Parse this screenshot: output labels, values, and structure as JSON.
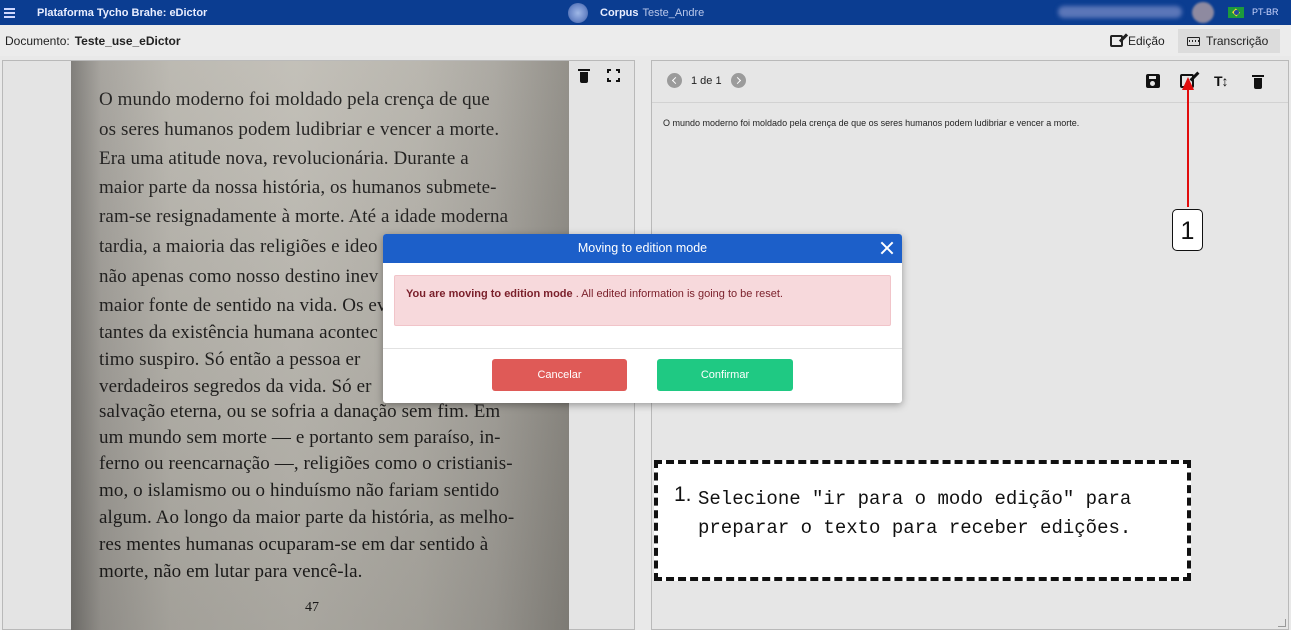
{
  "header": {
    "app_title": "Plataforma Tycho Brahe: eDictor",
    "corpus_label": "Corpus",
    "corpus_name": "Teste_Andre",
    "language": "PT-BR"
  },
  "docbar": {
    "doc_label": "Documento:",
    "doc_name": "Teste_use_eDictor",
    "edicao_label": "Edição",
    "transcricao_label": "Transcrição"
  },
  "book": {
    "lines": [
      "O mundo moderno foi moldado pela crença de que",
      "os seres humanos podem ludibriar e vencer a morte.",
      "Era uma atitude nova, revolucionária. Durante a",
      "maior parte da nossa história, os humanos submete-",
      "ram-se resignadamente à morte. Até a idade moderna",
      "tardia, a maioria das religiões e ideo",
      "não apenas como nosso destino inev",
      "maior fonte de sentido na vida. Os ev",
      "tantes da existência humana acontec",
      "timo suspiro. Só então a pessoa er",
      "verdadeiros segredos da vida. Só er",
      "salvação eterna, ou se sofria a danação sem fim. Em",
      "um mundo sem morte — e portanto sem paraíso, in-",
      "ferno ou reencarnação —, religiões como o cristianis-",
      "mo, o islamismo ou o hinduísmo não fariam sentido",
      "algum. Ao longo da maior parte da história, as melho-",
      "res mentes humanas ocuparam-se em dar sentido à",
      "morte, não em lutar para vencê-la."
    ],
    "page_number": "47"
  },
  "transcription": {
    "pager_text": "1 de 1",
    "text": "O mundo moderno foi moldado pela crença de que os seres humanos podem ludibriar e vencer a morte.",
    "text_size_icon": "T↕"
  },
  "modal": {
    "title": "Moving to edition mode",
    "alert_bold": "You are moving to edition mode",
    "alert_rest": " . All edited information is going to be reset.",
    "cancel_label": "Cancelar",
    "confirm_label": "Confirmar"
  },
  "annotation": {
    "callout_number": "1",
    "step_number": "1.",
    "step_text": "Selecione \"ir para o modo edição\" para preparar o texto para receber edições.",
    "arrow_color": "#e10c0c"
  },
  "icons": {
    "menu": "hamburger-icon",
    "corpus": "corpus-logo-icon",
    "flag": "brazil-flag-icon",
    "trash": "trash-icon",
    "fullscreen": "expand-icon",
    "prev": "chevron-left-icon",
    "next": "chevron-right-icon",
    "save": "save-icon",
    "edit": "edit-icon",
    "text_size": "text-size-icon",
    "close": "close-icon"
  }
}
